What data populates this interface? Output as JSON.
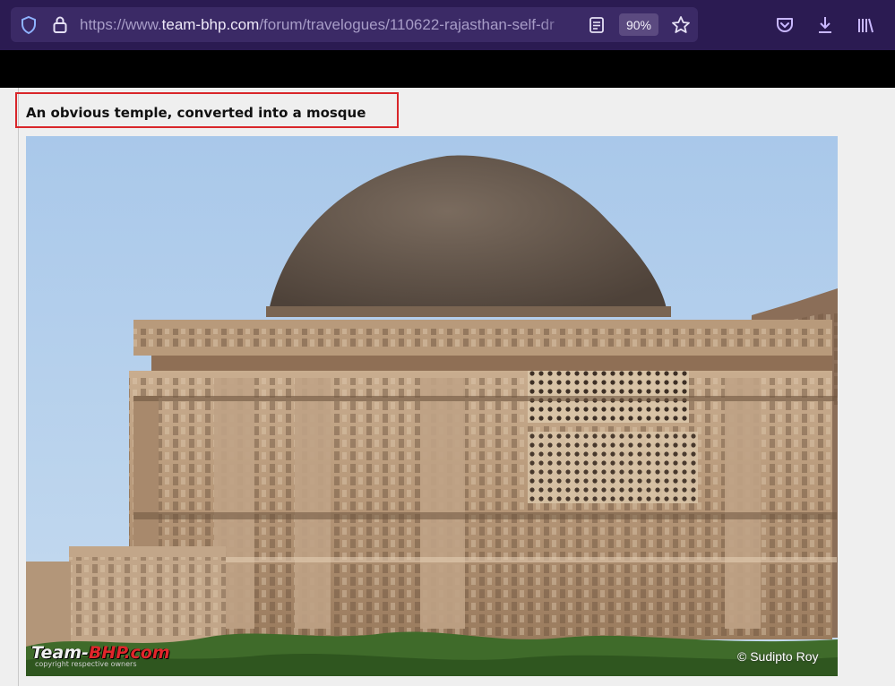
{
  "browser": {
    "url_prefix": "https://www.",
    "url_host": "team-bhp.com",
    "url_path": "/forum/travelogues/110622-rajasthan-self-dr",
    "zoom_label": "90%"
  },
  "post": {
    "caption": "An obvious temple, converted into a mosque",
    "image": {
      "watermark_team": "Team-",
      "watermark_bhp": "BHP.com",
      "watermark_sub": "copyright respective owners",
      "credit": "© Sudipto Roy"
    }
  },
  "colors": {
    "toolbar_bg": "#2b1b52",
    "urlbar_bg": "#3b2a66",
    "icon_color": "#c9b8ff",
    "highlight_border": "#d9262a"
  }
}
